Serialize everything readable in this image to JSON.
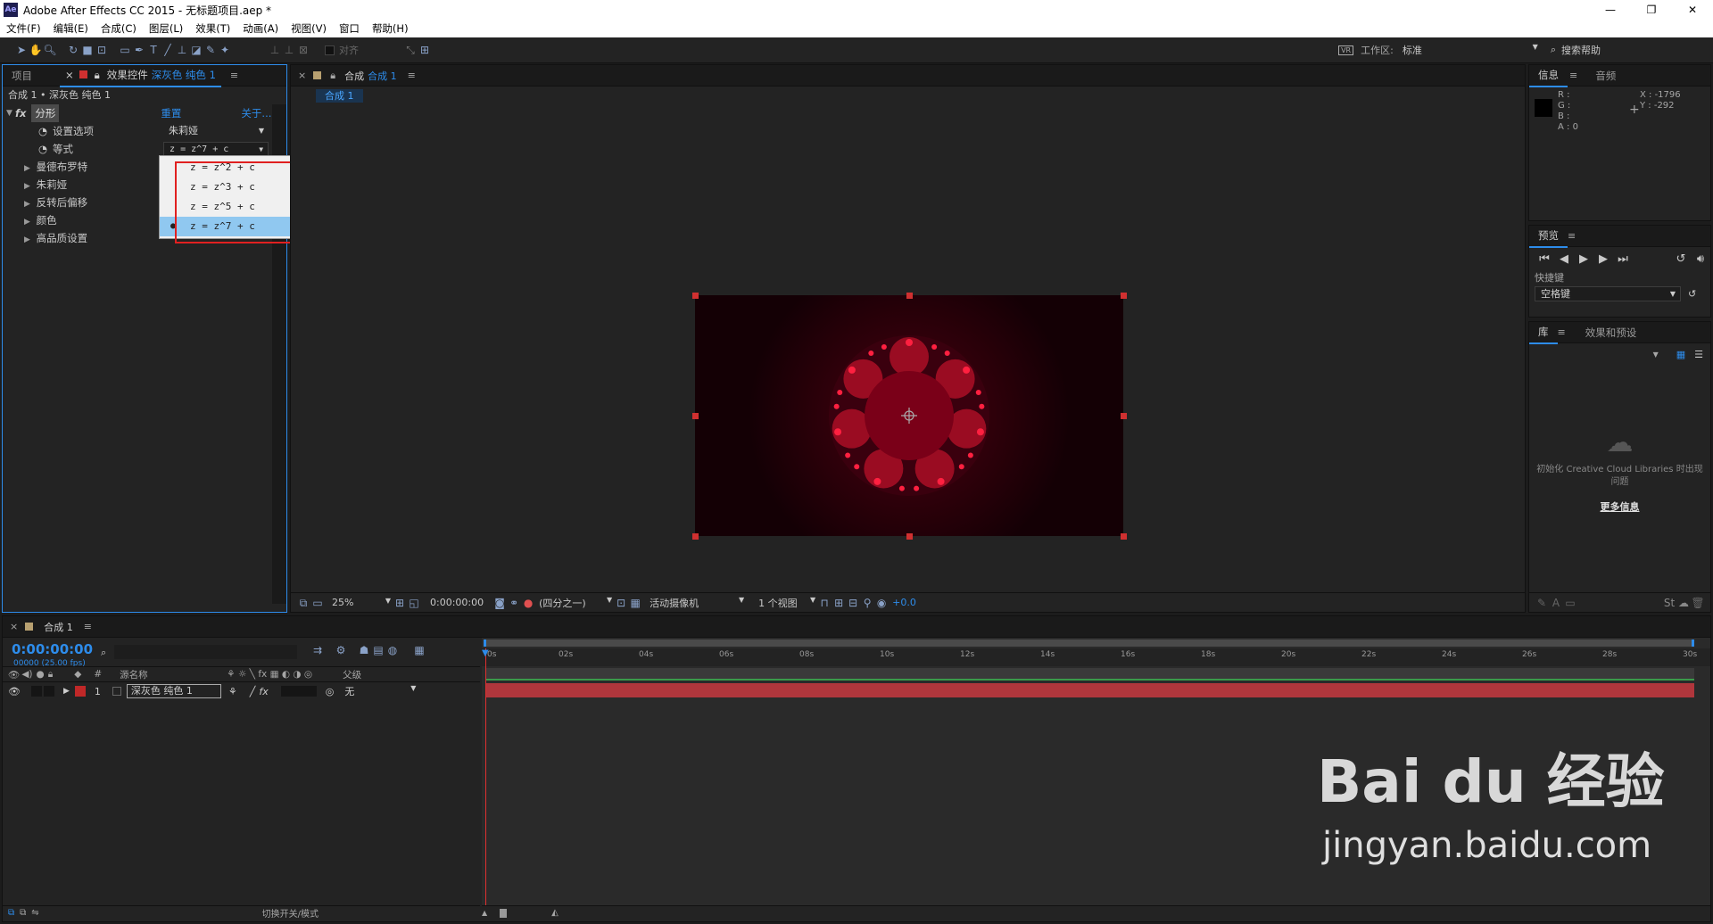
{
  "window": {
    "title": "Adobe After Effects CC 2015 - 无标题项目.aep *",
    "app_icon": "Ae",
    "controls": [
      "—",
      "❐",
      "✕"
    ]
  },
  "menu": [
    "文件(F)",
    "编辑(E)",
    "合成(C)",
    "图层(L)",
    "效果(T)",
    "动画(A)",
    "视图(V)",
    "窗口",
    "帮助(H)"
  ],
  "toolbar": {
    "align_label": "对齐",
    "workspace_label": "工作区:",
    "workspace_value": "标准",
    "search_label": "搜索帮助"
  },
  "left_panel": {
    "tab_project": "项目",
    "tab_effects": "效果控件",
    "tab_effects_layer": "深灰色 纯色 1",
    "breadcrumb": "合成 1 • 深灰色 纯色 1",
    "effect": {
      "name": "分形",
      "reset": "重置",
      "about": "关于..."
    },
    "props": [
      {
        "label": "设置选项",
        "value": "朱莉娅"
      },
      {
        "label": "等式",
        "value": "z = z^7 + c"
      }
    ],
    "groups": [
      "曼德布罗特",
      "朱莉娅",
      "反转后偏移",
      "颜色",
      "高品质设置"
    ],
    "dropdown_options": [
      "z = z^2 + c",
      "z = z^3 + c",
      "z = z^5 + c",
      "z = z^7 + c"
    ],
    "dropdown_selected_index": 3
  },
  "comp_panel": {
    "tab_label": "合成",
    "tab_comp": "合成 1",
    "subtab": "合成 1",
    "bottom": {
      "zoom": "25%",
      "time": "0:00:00:00",
      "resolution": "(四分之一)",
      "camera": "活动摄像机",
      "views": "1 个视图",
      "exposure": "+0.0"
    }
  },
  "info_panel": {
    "tab_info": "信息",
    "tab_audio": "音频",
    "rgba": [
      "R :",
      "G :",
      "B :",
      "A : 0"
    ],
    "x": "X : -1796",
    "y": "Y : -292"
  },
  "preview_panel": {
    "tab": "预览",
    "shortcut_label": "快捷键",
    "shortcut_value": "空格键"
  },
  "library_panel": {
    "tab_lib": "库",
    "tab_fx": "效果和预设",
    "cc_msg": "初始化 Creative Cloud Libraries 时出现问题",
    "more_info": "更多信息"
  },
  "timeline": {
    "tab": "合成 1",
    "timecode": "0:00:00:00",
    "fps": "00000 (25.00 fps)",
    "col_source": "源名称",
    "col_parent": "父级",
    "col_num": "#",
    "layer": {
      "num": "1",
      "name": "深灰色 纯色 1",
      "parent": "无"
    },
    "ticks": [
      "0s",
      "02s",
      "04s",
      "06s",
      "08s",
      "10s",
      "12s",
      "14s",
      "16s",
      "18s",
      "20s",
      "22s",
      "24s",
      "26s",
      "28s",
      "30s"
    ],
    "toggle_label": "切换开关/模式"
  },
  "watermark": {
    "brand": "Bai du 经验",
    "url": "jingyan.baidu.com"
  },
  "colors": {
    "accent": "#2d8ceb",
    "highlight_box": "#e02020",
    "layer_bar": "#b0363c",
    "menu_sel": "#90c8f0"
  }
}
